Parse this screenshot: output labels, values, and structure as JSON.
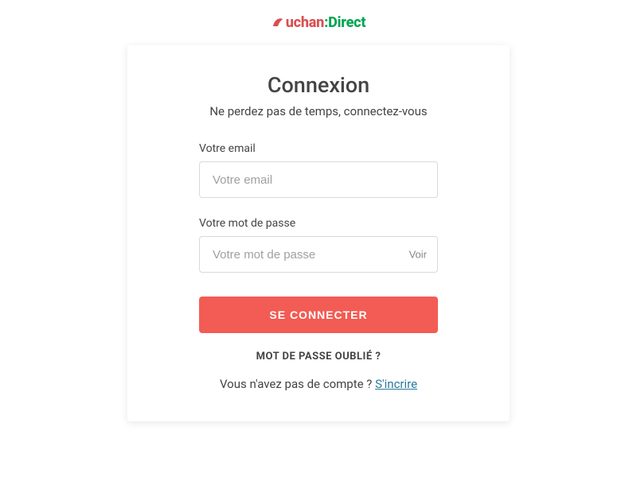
{
  "logo": {
    "auchan": "uchan",
    "colon": ":",
    "direct": "Direct"
  },
  "form": {
    "title": "Connexion",
    "subtitle": "Ne perdez pas de temps, connectez-vous",
    "email": {
      "label": "Votre email",
      "placeholder": "Votre email",
      "value": ""
    },
    "password": {
      "label": "Votre mot de passe",
      "placeholder": "Votre mot de passe",
      "value": "",
      "toggle": "Voir"
    },
    "submit": "SE CONNECTER",
    "forgot": "MOT DE PASSE OUBLIÉ ?",
    "signup_prompt": "Vous n'avez pas de compte ? ",
    "signup_link": "S'incrire"
  },
  "colors": {
    "brand_red": "#d94f4f",
    "brand_green": "#00a651",
    "button": "#f25c54",
    "link": "#2a7a9c"
  }
}
